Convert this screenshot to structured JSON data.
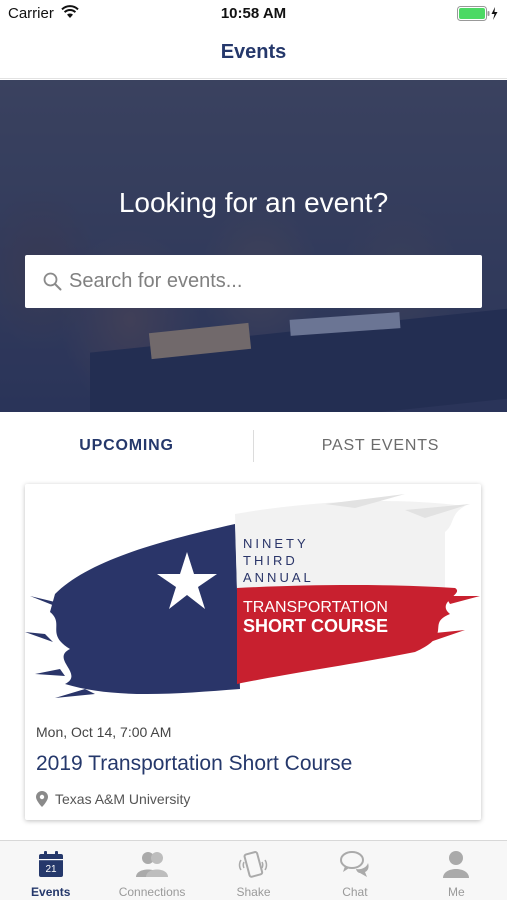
{
  "status_bar": {
    "carrier": "Carrier",
    "time": "10:58 AM"
  },
  "nav": {
    "title": "Events"
  },
  "hero": {
    "title": "Looking for an event?",
    "search_placeholder": "Search for events..."
  },
  "tabs": {
    "upcoming": "UPCOMING",
    "past": "PAST EVENTS",
    "active": "upcoming"
  },
  "event": {
    "logo": {
      "line1": "NINETY",
      "line2": "THIRD",
      "line3": "ANNUAL",
      "line4": "TRANSPORTATION",
      "line5": "SHORT COURSE"
    },
    "date": "Mon, Oct 14, 7:00 AM",
    "title": "2019 Transportation Short Course",
    "location": "Texas A&M University"
  },
  "tab_bar": {
    "items": [
      {
        "label": "Events",
        "icon": "calendar-icon",
        "badge": "21"
      },
      {
        "label": "Connections",
        "icon": "people-icon"
      },
      {
        "label": "Shake",
        "icon": "phone-shake-icon"
      },
      {
        "label": "Chat",
        "icon": "chat-bubbles-icon"
      },
      {
        "label": "Me",
        "icon": "person-icon"
      }
    ]
  },
  "colors": {
    "brand_navy": "#25386b",
    "texas_blue": "#2a3569",
    "texas_red": "#c8202f",
    "hero_overlay": "#1e2d5f"
  }
}
